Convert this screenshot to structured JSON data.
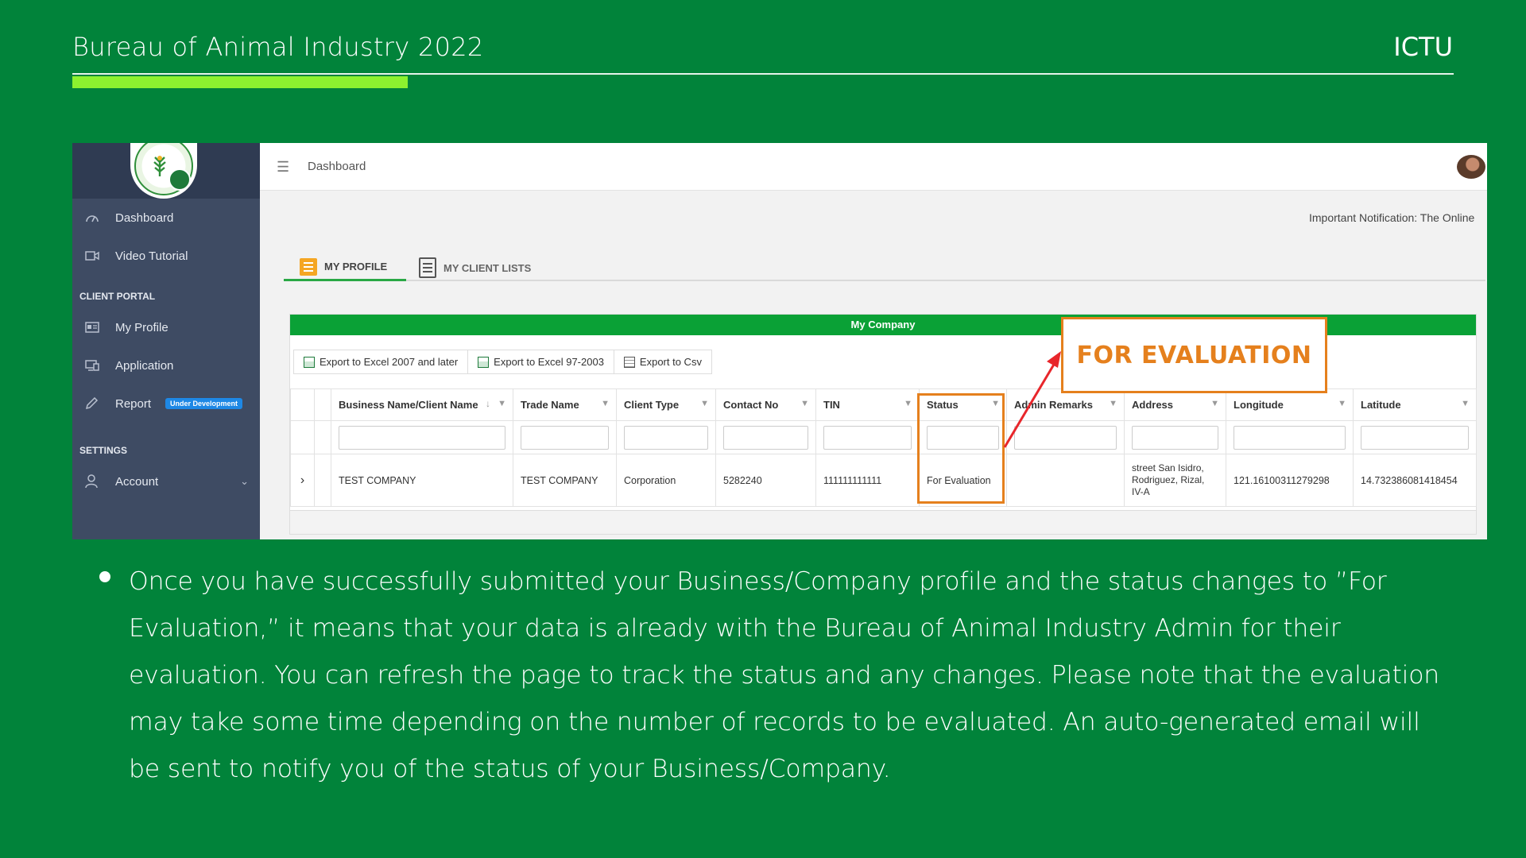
{
  "slide": {
    "title": "Bureau of Animal Industry 2022",
    "org": "ICTU",
    "body": "Once you have successfully submitted your Business/Company profile and the status changes to ”For Evaluation,” it means that your data is already with the Bureau of Animal Industry Admin for their evaluation. You can refresh the page to track the status and any changes. Please note that the evaluation may take some time depending on the number of records to be evaluated. An auto-generated email will be sent to notify you of the status of your Business/Company."
  },
  "app": {
    "sidebar": {
      "items": [
        {
          "label": "Dashboard",
          "icon": "dashboard-icon"
        },
        {
          "label": "Video Tutorial",
          "icon": "video-icon"
        }
      ],
      "client_portal_header": "CLIENT PORTAL",
      "client_portal_items": [
        {
          "label": "My Profile",
          "icon": "profile-card-icon"
        },
        {
          "label": "Application",
          "icon": "application-icon"
        },
        {
          "label": "Report",
          "icon": "pencil-icon",
          "badge": "Under Development"
        }
      ],
      "settings_header": "SETTINGS",
      "settings_items": [
        {
          "label": "Account",
          "icon": "user-icon"
        }
      ]
    },
    "topbar": {
      "breadcrumb": "Dashboard"
    },
    "notification": "Important Notification: The Online",
    "tabs": [
      {
        "label": "MY PROFILE",
        "active": true
      },
      {
        "label": "MY CLIENT LISTS",
        "active": false
      }
    ],
    "panel": {
      "title": "My Company",
      "exports": [
        "Export to Excel 2007 and later",
        "Export to Excel 97-2003",
        "Export to Csv"
      ],
      "columns": [
        "Business Name/Client Name",
        "Trade Name",
        "Client Type",
        "Contact No",
        "TIN",
        "Status",
        "Admin Remarks",
        "Address",
        "Longitude",
        "Latitude"
      ],
      "row": {
        "business_name": "TEST COMPANY",
        "trade_name": "TEST COMPANY",
        "client_type": "Corporation",
        "contact_no": "5282240",
        "tin": "111111111111",
        "status": "For Evaluation",
        "admin_remarks": "",
        "address": "street San Isidro, Rodriguez, Rizal, IV-A",
        "longitude": "121.16100311279298",
        "latitude": "14.732386081418454"
      }
    },
    "annotation": {
      "label": "FOR EVALUATION",
      "color": "#e5801d"
    }
  },
  "colors": {
    "slide_bg": "#01833a",
    "accent_bar": "#8cf12f",
    "panel_header": "#0aa136",
    "sidebar": "#3e4b63"
  }
}
